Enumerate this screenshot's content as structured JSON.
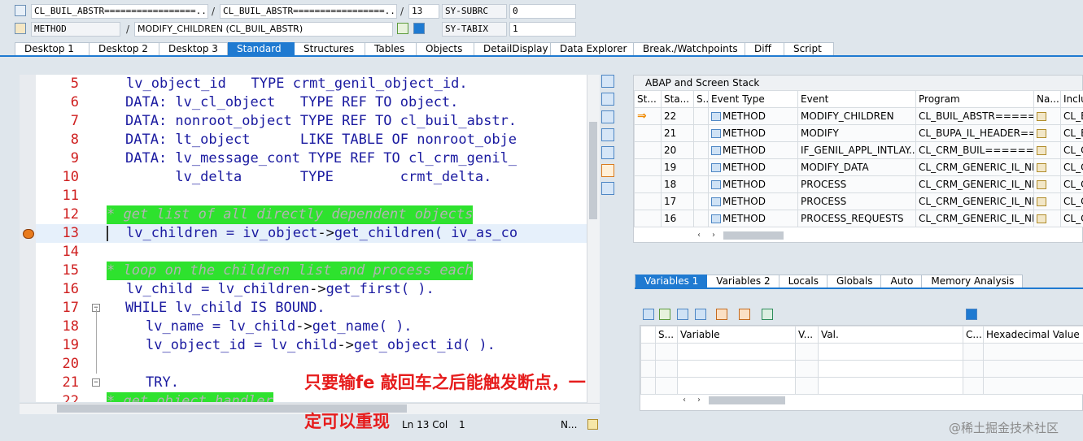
{
  "header": {
    "row1": {
      "field1": "CL_BUIL_ABSTR=================...",
      "field2": "CL_BUIL_ABSTR=================...",
      "line": "13",
      "sysvar": "SY-SUBRC",
      "sysval": "0"
    },
    "row2": {
      "type": "METHOD",
      "name": "MODIFY_CHILDREN (CL_BUIL_ABSTR)",
      "sysvar": "SY-TABIX",
      "sysval": "1"
    },
    "slash": "/"
  },
  "tabs": [
    "Desktop 1",
    "Desktop 2",
    "Desktop 3",
    "Standard",
    "Structures",
    "Tables",
    "Objects",
    "DetailDisplay",
    "Data Explorer",
    "Break./Watchpoints",
    "Diff",
    "Script"
  ],
  "editor": {
    "lines": [
      {
        "n": "5",
        "code": "      lv_object_id   TYPE crmt_genil_object_id."
      },
      {
        "n": "6",
        "code": "DATA: lv_cl_object   TYPE REF TO object."
      },
      {
        "n": "7",
        "code": "DATA: nonroot_object TYPE REF TO cl_buil_abstr."
      },
      {
        "n": "8",
        "code": "DATA: lt_object      LIKE TABLE OF nonroot_obje"
      },
      {
        "n": "9",
        "code": "DATA: lv_message_cont TYPE REF TO cl_crm_genil_"
      },
      {
        "n": "10",
        "code": "      lv_delta       TYPE        crmt_delta."
      },
      {
        "n": "11",
        "code": ""
      },
      {
        "n": "12",
        "code": "* get list of all directly dependent objects"
      },
      {
        "n": "13",
        "code": "lv_children = iv_object->get_children( iv_as_co"
      },
      {
        "n": "14",
        "code": ""
      },
      {
        "n": "15",
        "code": "* loop on the children list and process each"
      },
      {
        "n": "16",
        "code": "lv_child = lv_children->get_first( )."
      },
      {
        "n": "17",
        "code": "WHILE lv_child IS BOUND."
      },
      {
        "n": "18",
        "code": "  lv_name = lv_child->get_name( )."
      },
      {
        "n": "19",
        "code": "  lv_object_id = lv_child->get_object_id( )."
      },
      {
        "n": "20",
        "code": ""
      },
      {
        "n": "21",
        "code": "  TRY."
      },
      {
        "n": "22",
        "code": "* get object handler"
      }
    ],
    "status": {
      "pos": "Ln 13 Col",
      "col": "1",
      "mode": "N..."
    }
  },
  "stack": {
    "title": "ABAP and Screen Stack",
    "columns": [
      "St...",
      "Sta...",
      "S...",
      "Event Type",
      "Event",
      "Program",
      "Na...",
      "Inclu"
    ],
    "rows": [
      {
        "current": "⇒",
        "level": "22",
        "type": "METHOD",
        "event": "MODIFY_CHILDREN",
        "program": "CL_BUIL_ABSTR=====...",
        "incl": "CL_B"
      },
      {
        "current": "",
        "level": "21",
        "type": "METHOD",
        "event": "MODIFY",
        "program": "CL_BUPA_IL_HEADER==...",
        "incl": "CL_B"
      },
      {
        "current": "",
        "level": "20",
        "type": "METHOD",
        "event": "IF_GENIL_APPL_INTLAY...",
        "program": "CL_CRM_BUIL========...",
        "incl": "CL_C"
      },
      {
        "current": "",
        "level": "19",
        "type": "METHOD",
        "event": "MODIFY_DATA",
        "program": "CL_CRM_GENERIC_IL_NE...",
        "incl": "CL_C"
      },
      {
        "current": "",
        "level": "18",
        "type": "METHOD",
        "event": "PROCESS",
        "program": "CL_CRM_GENERIC_IL_NE...",
        "incl": "CL_C"
      },
      {
        "current": "",
        "level": "17",
        "type": "METHOD",
        "event": "PROCESS",
        "program": "CL_CRM_GENERIC_IL_NE...",
        "incl": "CL_C"
      },
      {
        "current": "",
        "level": "16",
        "type": "METHOD",
        "event": "PROCESS_REQUESTS",
        "program": "CL_CRM_GENERIC_IL_NE...",
        "incl": "CL_C"
      }
    ]
  },
  "vars": {
    "tabs": [
      "Variables 1",
      "Variables 2",
      "Locals",
      "Globals",
      "Auto",
      "Memory Analysis"
    ],
    "columns": [
      "S...",
      "Variable",
      "V...",
      "Val.",
      "C...",
      "Hexadecimal Value"
    ]
  },
  "overlay": {
    "line1": "只要输fe 敲回车之后能触发断点，一",
    "line2": "定可以重现"
  },
  "watermark": "@稀土掘金技术社区",
  "colors": {
    "accent": "#1f7ad1",
    "comment_bg": "#2ee22e",
    "linenum": "#cf1f1f",
    "keyword": "#1a1aa0",
    "overlay": "#e61c1c"
  }
}
